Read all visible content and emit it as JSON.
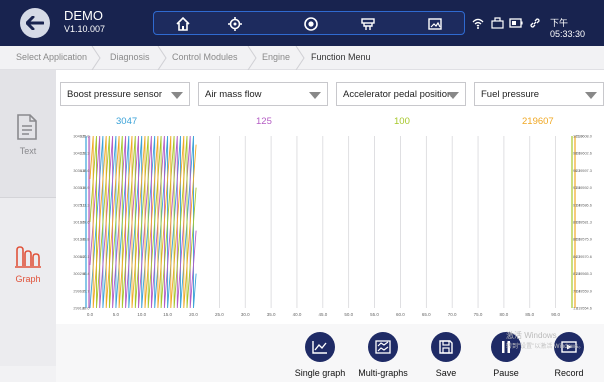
{
  "header": {
    "app_name": "DEMO",
    "version": "V1.10.007",
    "time": "下午 05:33:30"
  },
  "breadcrumbs": [
    "Select Application",
    "Diagnosis",
    "Control Modules",
    "Engine",
    "Function Menu"
  ],
  "sidebar": {
    "text_label": "Text",
    "graph_label": "Graph"
  },
  "selectors": [
    {
      "label": "Boost pressure sensor",
      "value": "3047",
      "color": "#3aa2d8"
    },
    {
      "label": "Air mass flow",
      "value": "125",
      "color": "#b45cc4"
    },
    {
      "label": "Accelerator pedal position",
      "value": "100",
      "color": "#a6c72a"
    },
    {
      "label": "Fuel pressure",
      "value": "219607",
      "color": "#f0a824"
    }
  ],
  "chart_data": {
    "type": "line",
    "x_ticks": [
      "0.0",
      "5.0",
      "10.0",
      "15.0",
      "20.0",
      "25.0",
      "30.0",
      "35.0",
      "40.0",
      "45.0",
      "50.0",
      "55.0",
      "60.0",
      "65.0",
      "70.0",
      "75.0",
      "80.0",
      "85.0",
      "90.0"
    ],
    "left_ticks_1": [
      "3049.0",
      "3042.9",
      "3036.8",
      "3030.8",
      "3025.1",
      "3019.5",
      "3013.8",
      "3008.2",
      "3002.4",
      "2996.7",
      "2991.0"
    ],
    "left_ticks_2": [
      "125.0",
      "122.3",
      "118.6",
      "114.9",
      "111.3",
      "107.6",
      "103.8",
      "100.1",
      "96.4",
      "92.7",
      "89.0"
    ],
    "right_ticks_1": [
      "101.0",
      "98.6",
      "96.2",
      "93.8",
      "91.4",
      "89.0",
      "86.6",
      "84.2",
      "81.8",
      "79.4",
      "1.0"
    ],
    "right_ticks_2": [
      "219608.0",
      "219602.6",
      "219597.3",
      "219592.0",
      "219586.6",
      "219581.3",
      "219575.9",
      "219570.6",
      "219565.3",
      "219559.9",
      "219554.6"
    ],
    "x_range": [
      0,
      92
    ],
    "cycle_period": 2.5,
    "data_end_x": 20.5,
    "grid": true
  },
  "toolbar": {
    "single_graph": "Single graph",
    "multi_graphs": "Multi-graphs",
    "save": "Save",
    "pause": "Pause",
    "record": "Record"
  },
  "watermark": {
    "line1": "激活 Windows",
    "line2": "转到\"设置\"以激活 Windows。"
  }
}
